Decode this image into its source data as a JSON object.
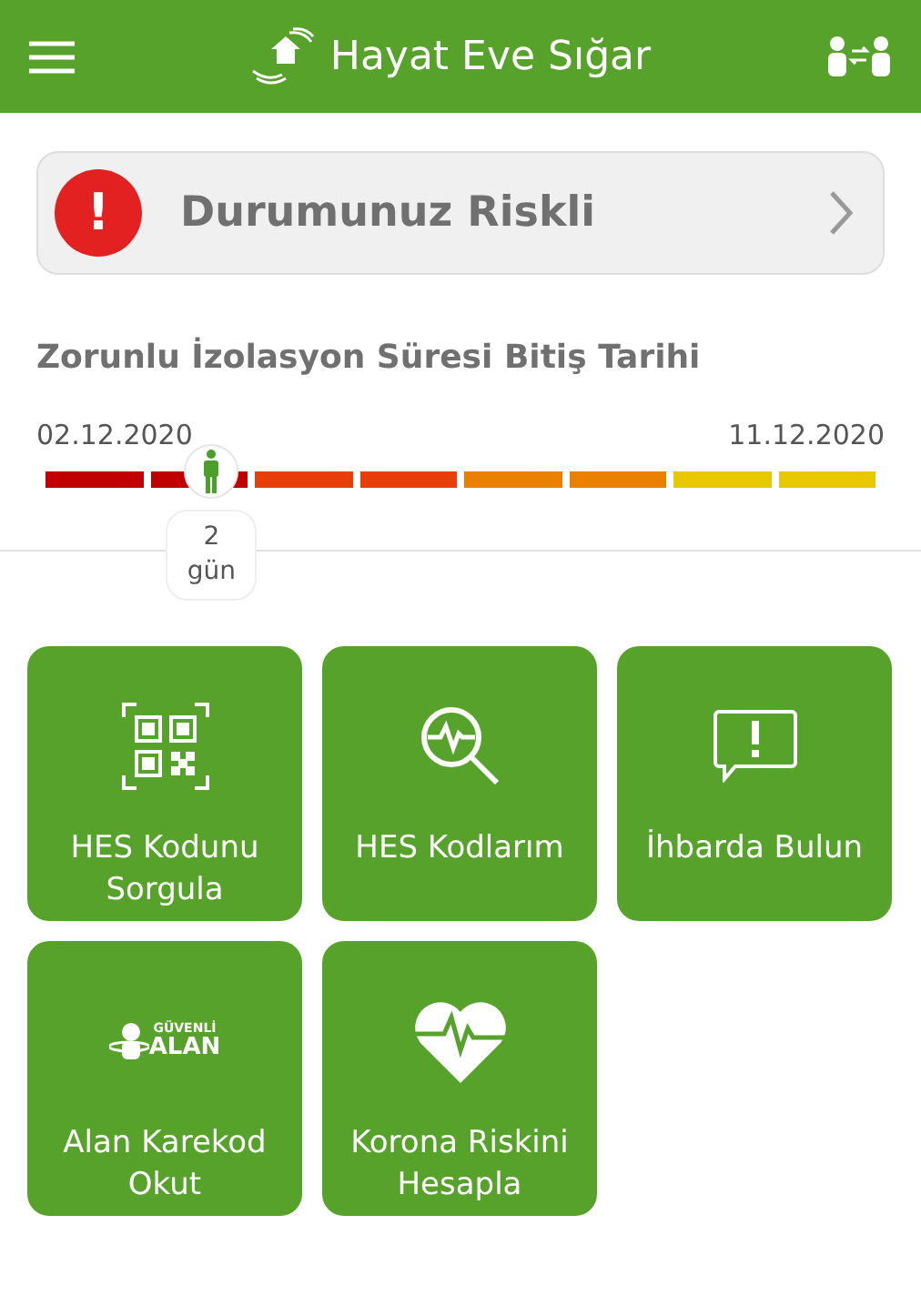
{
  "header": {
    "title": "Hayat Eve Sığar"
  },
  "status": {
    "text": "Durumunuz Riskli",
    "icon": "!"
  },
  "isolation": {
    "title": "Zorunlu İzolasyon Süresi Bitiş Tarihi",
    "start": "02.12.2020",
    "end": "11.12.2020",
    "segments": [
      {
        "color": "#c00000"
      },
      {
        "color": "#c00000"
      },
      {
        "color": "#e83e0a"
      },
      {
        "color": "#e83e0a"
      },
      {
        "color": "#ea8000"
      },
      {
        "color": "#ea8000"
      },
      {
        "color": "#e8c800"
      },
      {
        "color": "#e8c800"
      }
    ],
    "elapsed": [
      "2",
      "gün"
    ]
  },
  "tiles": [
    {
      "kind": "qr",
      "label": [
        "HES Kodunu",
        "Sorgula"
      ]
    },
    {
      "kind": "search",
      "label": [
        "HES Kodlarım"
      ]
    },
    {
      "kind": "report",
      "label": [
        "İhbarda Bulun"
      ]
    },
    {
      "kind": "area",
      "logo": [
        "GÜVENLİ",
        "ALAN"
      ],
      "label": [
        "Alan Karekod",
        "Okut"
      ]
    },
    {
      "kind": "heart",
      "label": [
        "Korona Riskini",
        "Hesapla"
      ]
    }
  ]
}
